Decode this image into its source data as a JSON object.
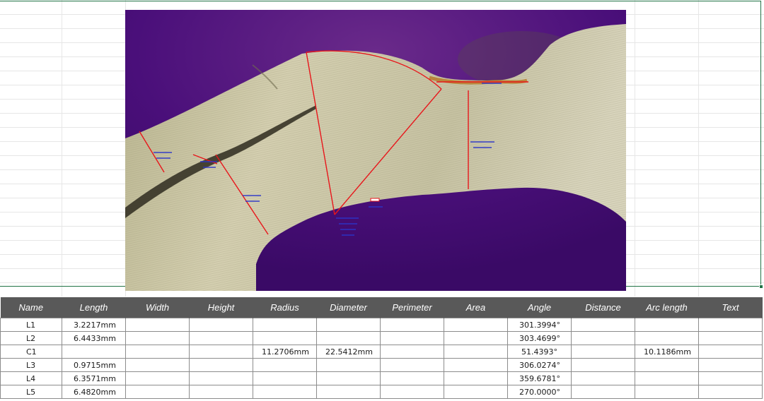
{
  "table": {
    "columns": [
      "Name",
      "Length",
      "Width",
      "Height",
      "Radius",
      "Diameter",
      "Perimeter",
      "Area",
      "Angle",
      "Distance",
      "Arc length",
      "Text"
    ],
    "rows": [
      {
        "name": "L1",
        "length": "3.2217mm",
        "width": "",
        "height": "",
        "radius": "",
        "diameter": "",
        "perimeter": "",
        "area": "",
        "angle": "301.3994°",
        "distance": "",
        "arc_length": "",
        "text": ""
      },
      {
        "name": "L2",
        "length": "6.4433mm",
        "width": "",
        "height": "",
        "radius": "",
        "diameter": "",
        "perimeter": "",
        "area": "",
        "angle": "303.4699°",
        "distance": "",
        "arc_length": "",
        "text": ""
      },
      {
        "name": "C1",
        "length": "",
        "width": "",
        "height": "",
        "radius": "11.2706mm",
        "diameter": "22.5412mm",
        "perimeter": "",
        "area": "",
        "angle": "51.4393°",
        "distance": "",
        "arc_length": "10.1186mm",
        "text": ""
      },
      {
        "name": "L3",
        "length": "0.9715mm",
        "width": "",
        "height": "",
        "radius": "",
        "diameter": "",
        "perimeter": "",
        "area": "",
        "angle": "306.0274°",
        "distance": "",
        "arc_length": "",
        "text": ""
      },
      {
        "name": "L4",
        "length": "6.3571mm",
        "width": "",
        "height": "",
        "radius": "",
        "diameter": "",
        "perimeter": "",
        "area": "",
        "angle": "359.6781°",
        "distance": "",
        "arc_length": "",
        "text": ""
      },
      {
        "name": "L5",
        "length": "6.4820mm",
        "width": "",
        "height": "",
        "radius": "",
        "diameter": "",
        "perimeter": "",
        "area": "",
        "angle": "270.0000°",
        "distance": "",
        "arc_length": "",
        "text": ""
      }
    ]
  },
  "colors": {
    "header_bg": "#595959",
    "selection": "#217346",
    "measure_line": "#e8161b",
    "annotation": "#2b35c9",
    "background_purple": "#4a0f7a",
    "metal": "#c9c4a4"
  },
  "icons": {
    "selection_handle": "resize-handle-icon"
  }
}
